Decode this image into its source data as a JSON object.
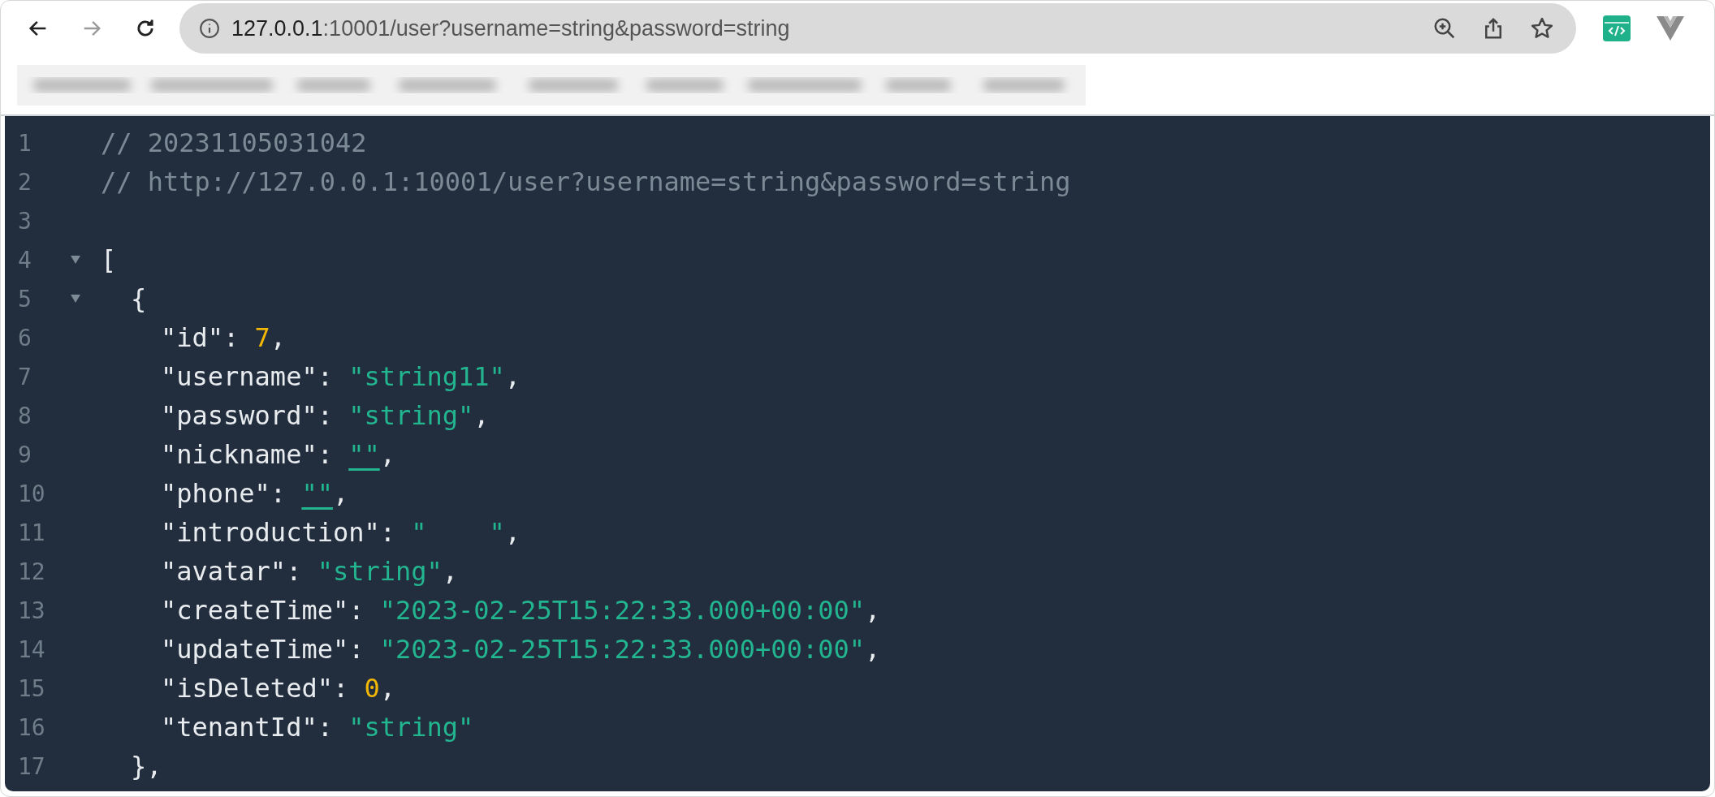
{
  "toolbar": {
    "back": {
      "disabled": false
    },
    "forward": {
      "disabled": true
    },
    "address": {
      "host": "127.0.0.1",
      "path": ":10001/user?username=string&password=string"
    }
  },
  "viewer": {
    "lines": [
      {
        "number": "1",
        "tokens": [
          {
            "kind": "comment",
            "text": "// 20231105031042"
          }
        ]
      },
      {
        "number": "2",
        "tokens": [
          {
            "kind": "comment",
            "text": "// http://127.0.0.1:10001/user?username=string&password=string"
          }
        ]
      },
      {
        "number": "3"
      },
      {
        "number": "4",
        "expanded": true,
        "tokens": [
          {
            "text": "["
          }
        ],
        "children": [
          {
            "number": "5",
            "expanded": true,
            "tokens": [
              {
                "text": "{"
              }
            ],
            "children": [
              {
                "number": "6",
                "tokens": [
                  {
                    "text": "\"id\": "
                  },
                  {
                    "kind": "number",
                    "text": "7"
                  },
                  {
                    "text": ","
                  }
                ]
              },
              {
                "number": "7",
                "tokens": [
                  {
                    "text": "\"username\": "
                  },
                  {
                    "kind": "string",
                    "text": "\"string11\""
                  },
                  {
                    "text": ","
                  }
                ]
              },
              {
                "number": "8",
                "tokens": [
                  {
                    "text": "\"password\": "
                  },
                  {
                    "kind": "string",
                    "text": "\"string\""
                  },
                  {
                    "text": ","
                  }
                ]
              },
              {
                "number": "9",
                "tokens": [
                  {
                    "text": "\"nickname\": "
                  },
                  {
                    "kind": "empty",
                    "text": "\"\""
                  },
                  {
                    "text": ","
                  }
                ]
              },
              {
                "number": "10",
                "tokens": [
                  {
                    "text": "\"phone\": "
                  },
                  {
                    "kind": "empty",
                    "text": "\"\""
                  },
                  {
                    "text": ","
                  }
                ]
              },
              {
                "number": "11",
                "tokens": [
                  {
                    "text": "\"introduction\": "
                  },
                  {
                    "kind": "string",
                    "text": "\"    \""
                  },
                  {
                    "text": ","
                  }
                ]
              },
              {
                "number": "12",
                "tokens": [
                  {
                    "text": "\"avatar\": "
                  },
                  {
                    "kind": "string",
                    "text": "\"string\""
                  },
                  {
                    "text": ","
                  }
                ]
              },
              {
                "number": "13",
                "tokens": [
                  {
                    "text": "\"createTime\": "
                  },
                  {
                    "kind": "string",
                    "text": "\"2023-02-25T15:22:33.000+00:00\""
                  },
                  {
                    "text": ","
                  }
                ]
              },
              {
                "number": "14",
                "tokens": [
                  {
                    "text": "\"updateTime\": "
                  },
                  {
                    "kind": "string",
                    "text": "\"2023-02-25T15:22:33.000+00:00\""
                  },
                  {
                    "text": ","
                  }
                ]
              },
              {
                "number": "15",
                "tokens": [
                  {
                    "text": "\"isDeleted\": "
                  },
                  {
                    "kind": "number",
                    "text": "0"
                  },
                  {
                    "text": ","
                  }
                ]
              },
              {
                "number": "16",
                "tokens": [
                  {
                    "text": "\"tenantId\": "
                  },
                  {
                    "kind": "string",
                    "text": "\"string\""
                  }
                ]
              }
            ],
            "close": {
              "number": "17",
              "tokens": [
                {
                  "text": "},"
                }
              ]
            }
          }
        ]
      }
    ]
  }
}
